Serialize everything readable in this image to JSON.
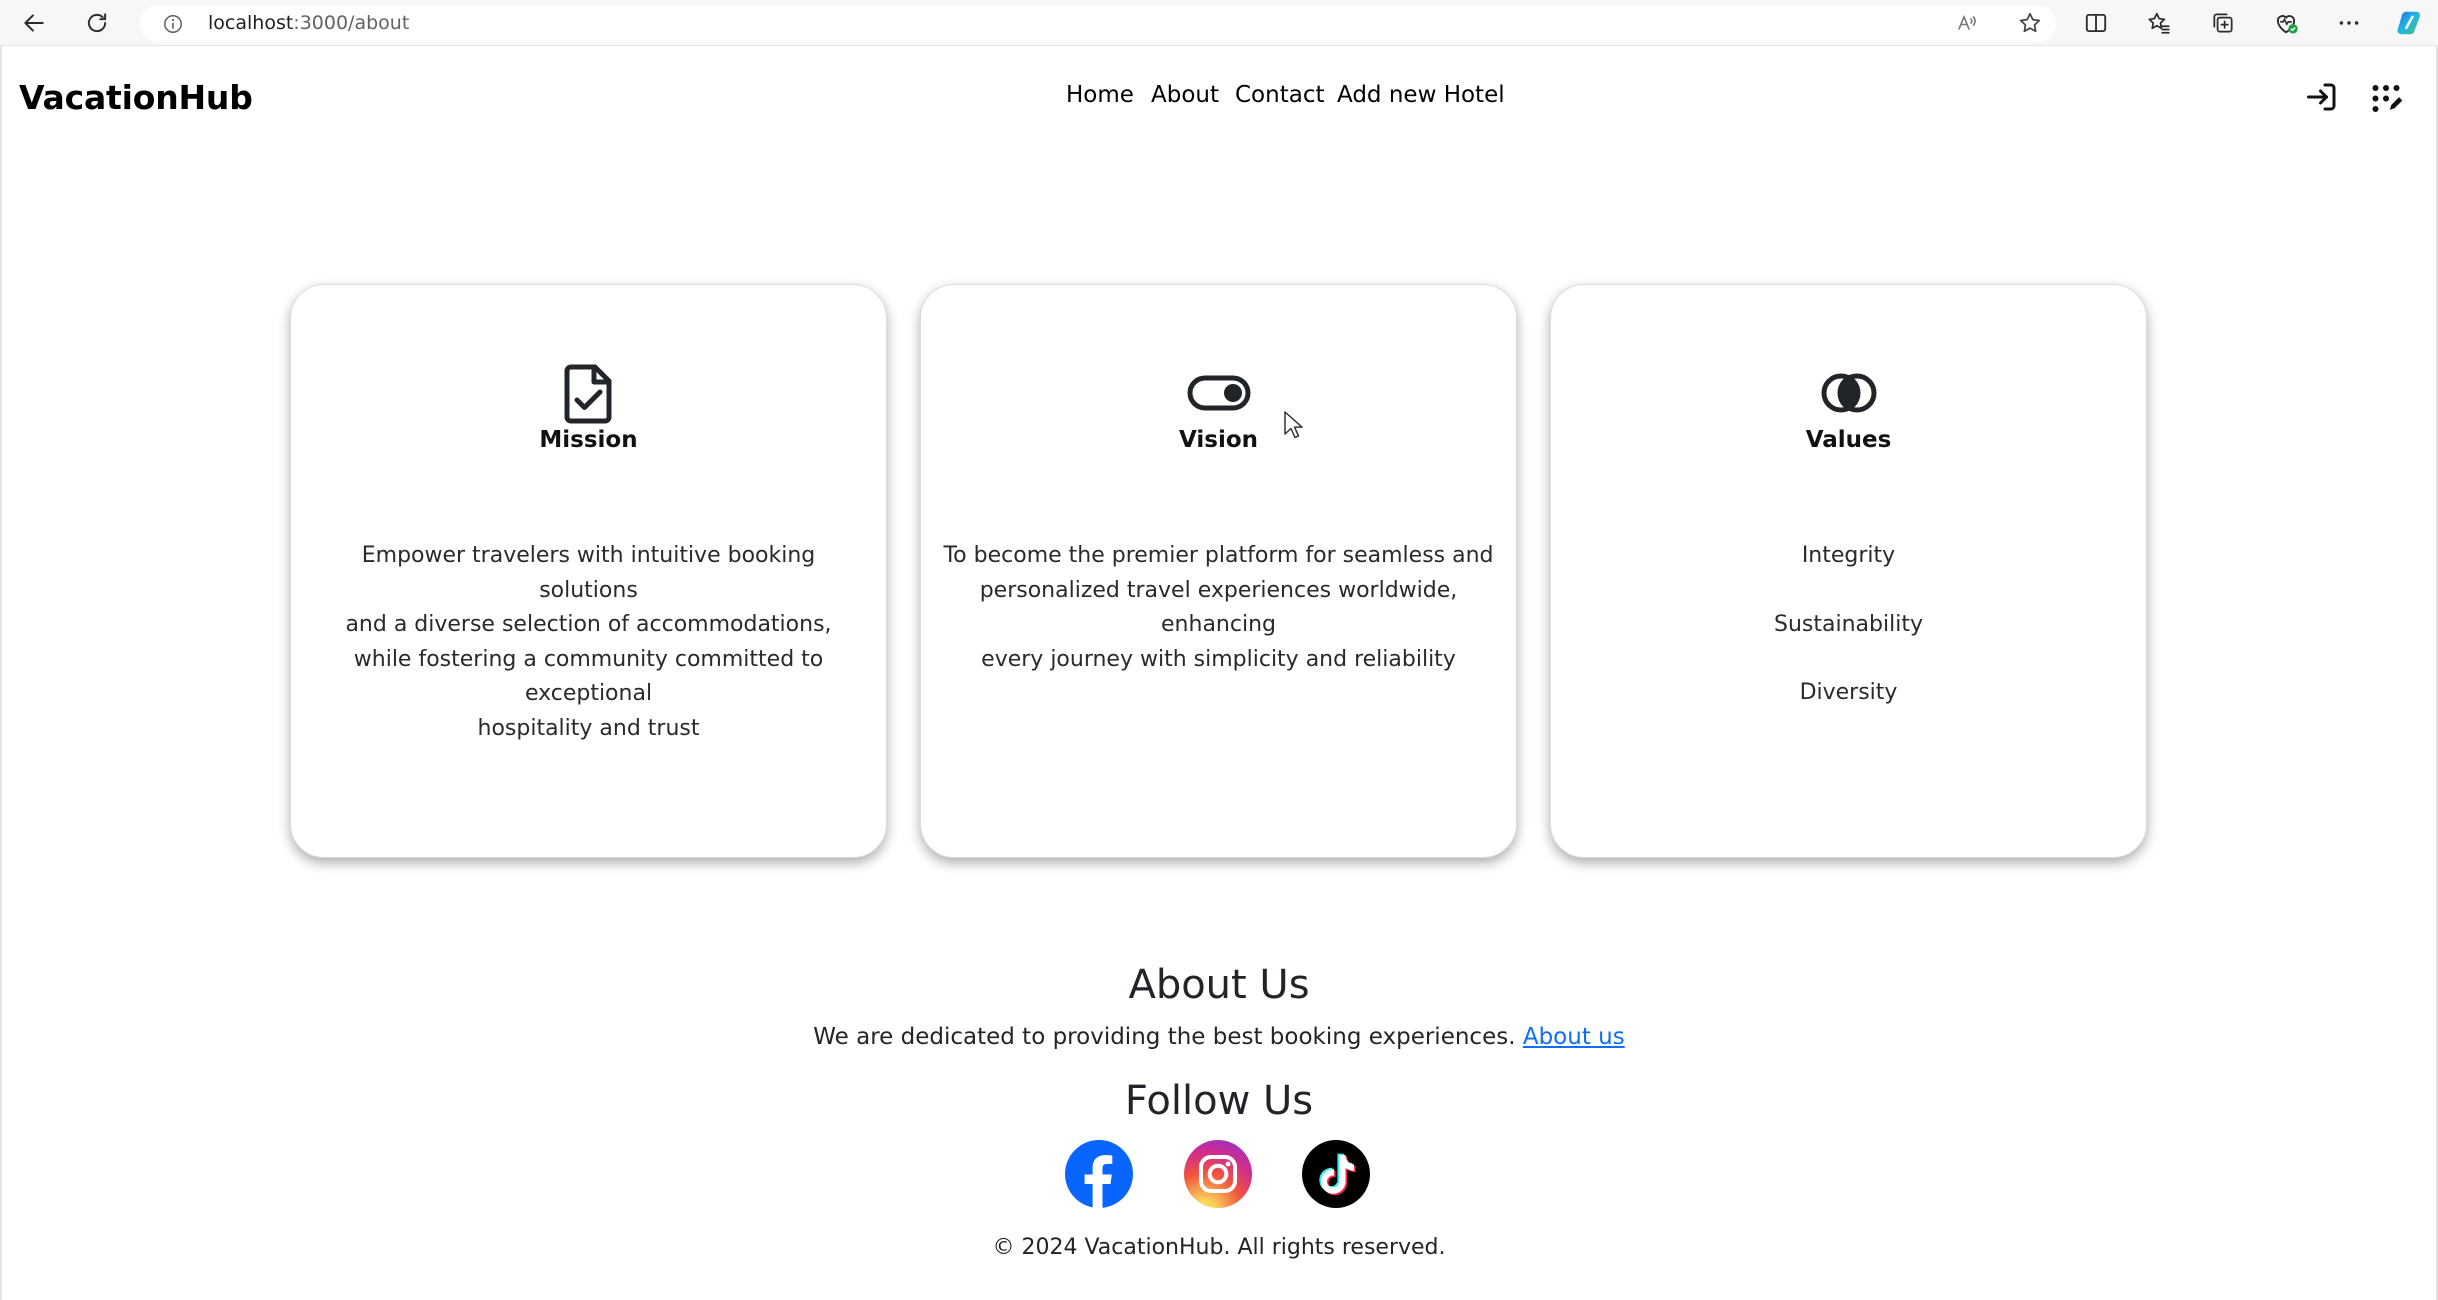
{
  "browser": {
    "url_host": "localhost",
    "url_path": ":3000/about"
  },
  "navbar": {
    "brand": "VacationHub",
    "links": [
      {
        "label": "Home"
      },
      {
        "label": "About"
      },
      {
        "label": "Contact"
      },
      {
        "label": "Add new Hotel"
      }
    ],
    "icons": [
      "login-icon",
      "grid-menu-icon"
    ]
  },
  "cards": {
    "mission": {
      "icon": "file-check-icon",
      "title": "Mission",
      "lines": [
        "Empower travelers with intuitive booking solutions",
        "and a diverse selection of accommodations,",
        "while fostering a community committed to exceptional",
        "hospitality and trust"
      ]
    },
    "vision": {
      "icon": "toggle-on-icon",
      "title": "Vision",
      "lines": [
        "To become the premier platform for seamless and",
        "personalized travel experiences worldwide, enhancing",
        "every journey with simplicity and reliability"
      ]
    },
    "values": {
      "icon": "intersecting-circles-icon",
      "title": "Values",
      "items": [
        "Integrity",
        "Sustainability",
        "Diversity"
      ]
    }
  },
  "about_section": {
    "heading": "About Us",
    "text": "We are dedicated to providing the best booking experiences.",
    "link_label": "About us"
  },
  "follow_section": {
    "heading": "Follow Us",
    "socials": [
      "facebook-icon",
      "instagram-icon",
      "tiktok-icon"
    ]
  },
  "footer": {
    "copyright": "© 2024 VacationHub. All rights reserved."
  },
  "colors": {
    "link": "#0d6efd",
    "facebook": "#0866ff",
    "text": "#212529"
  }
}
